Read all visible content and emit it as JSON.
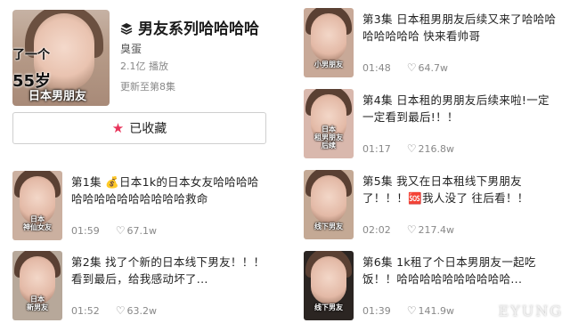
{
  "header": {
    "cover": {
      "caption1": "了一个",
      "caption2": "55岁",
      "caption3": "日本男朋友"
    },
    "title": "男友系列哈哈哈哈",
    "author": "臭蛋",
    "plays": "2.1亿 播放",
    "updated": "更新至第8集",
    "collect_label": "已收藏"
  },
  "episodes_left": [
    {
      "title": "第1集  💰日本1k的日本女友哈哈哈哈哈哈哈哈哈哈哈哈哈哈救命",
      "duration": "01:59",
      "likes": "67.1w",
      "thumb_label": "日本\n神仙女友",
      "thumb_bg": "#cbb0a0"
    },
    {
      "title": "第2集  找了个新的日本线下男友！！！看到最后，给我感动坏了...",
      "duration": "01:52",
      "likes": "63.2w",
      "thumb_label": "日本\n新男友",
      "thumb_bg": "#b7a89a"
    }
  ],
  "episodes_right": [
    {
      "title": "第3集  日本租男朋友后续又来了哈哈哈哈哈哈哈哈 快来看帅哥",
      "duration": "01:48",
      "likes": "64.7w",
      "thumb_label": "小男朋友",
      "thumb_bg": "#c8a998"
    },
    {
      "title": "第4集  日本租的男朋友后续来啦!一定一定看到最后!！！",
      "duration": "01:17",
      "likes": "216.8w",
      "thumb_label": "日本\n租男朋友\n后续",
      "thumb_bg": "#d9b8ad"
    },
    {
      "title": "第5集  我又在日本租线下男朋友了！！！🆘我人没了 往后看！！",
      "duration": "02:02",
      "likes": "217.4w",
      "thumb_label": "线下男友",
      "thumb_bg": "#c4a995"
    },
    {
      "title": "第6集  1k租了个日本男朋友一起吃饭！！哈哈哈哈哈哈哈哈哈哈...",
      "duration": "01:39",
      "likes": "141.9w",
      "thumb_label": "线下男友",
      "thumb_bg": "#2b2522"
    }
  ],
  "watermark": "EYUNG",
  "colors": {
    "accent": "#e8335a",
    "meta": "#888888"
  },
  "icons": {
    "layers": "layers-icon",
    "star": "star-icon",
    "heart": "heart-icon"
  }
}
